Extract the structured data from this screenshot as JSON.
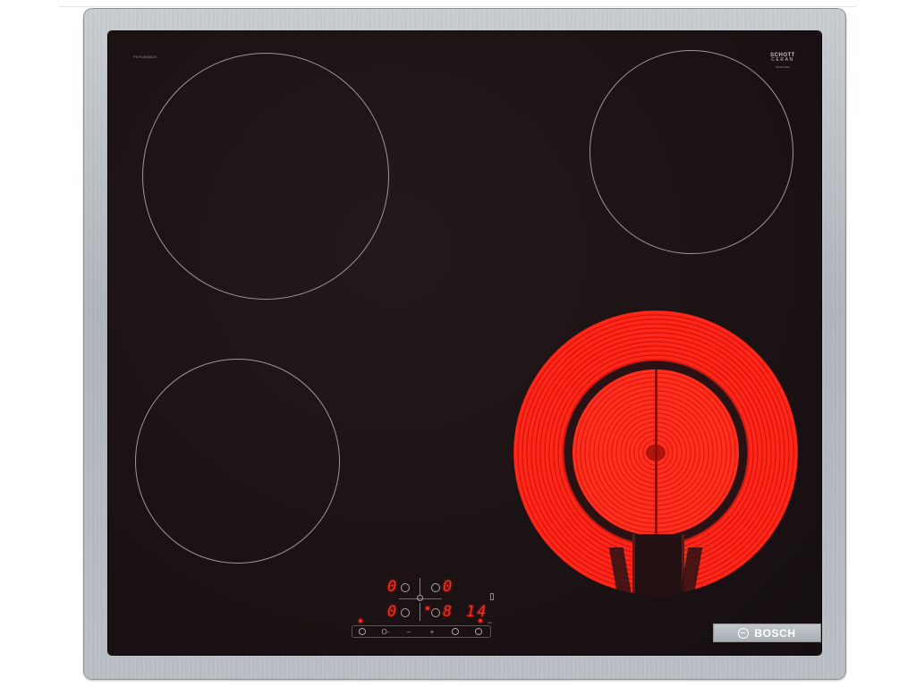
{
  "cooktop": {
    "model_code": "PKF645BB2E",
    "glass_brand_line1": "SCHOTT",
    "glass_brand_line2": "CERAN",
    "glass_brand_line3": "DESIGNED"
  },
  "brand_plate": {
    "text": "BOSCH",
    "logo": "bosch-armature-logo"
  },
  "display": {
    "top_left_digit": "0",
    "top_right_digit": "0",
    "bottom_left_digit": "0",
    "bottom_right_digit": "8",
    "timer_digits": "14",
    "timer_unit": "min"
  },
  "zones": {
    "front_right_active": true,
    "heat_color": "#ff2418"
  },
  "touch_controls": [
    {
      "name": "power",
      "icon": "power-icon"
    },
    {
      "name": "lock",
      "icon": "key-icon",
      "label": "O-"
    },
    {
      "name": "minus",
      "icon": "minus-icon",
      "label": "–"
    },
    {
      "name": "plus",
      "icon": "plus-icon",
      "label": "+"
    },
    {
      "name": "zone-select",
      "icon": "zone-select-icon"
    },
    {
      "name": "timer",
      "icon": "timer-icon"
    }
  ]
}
